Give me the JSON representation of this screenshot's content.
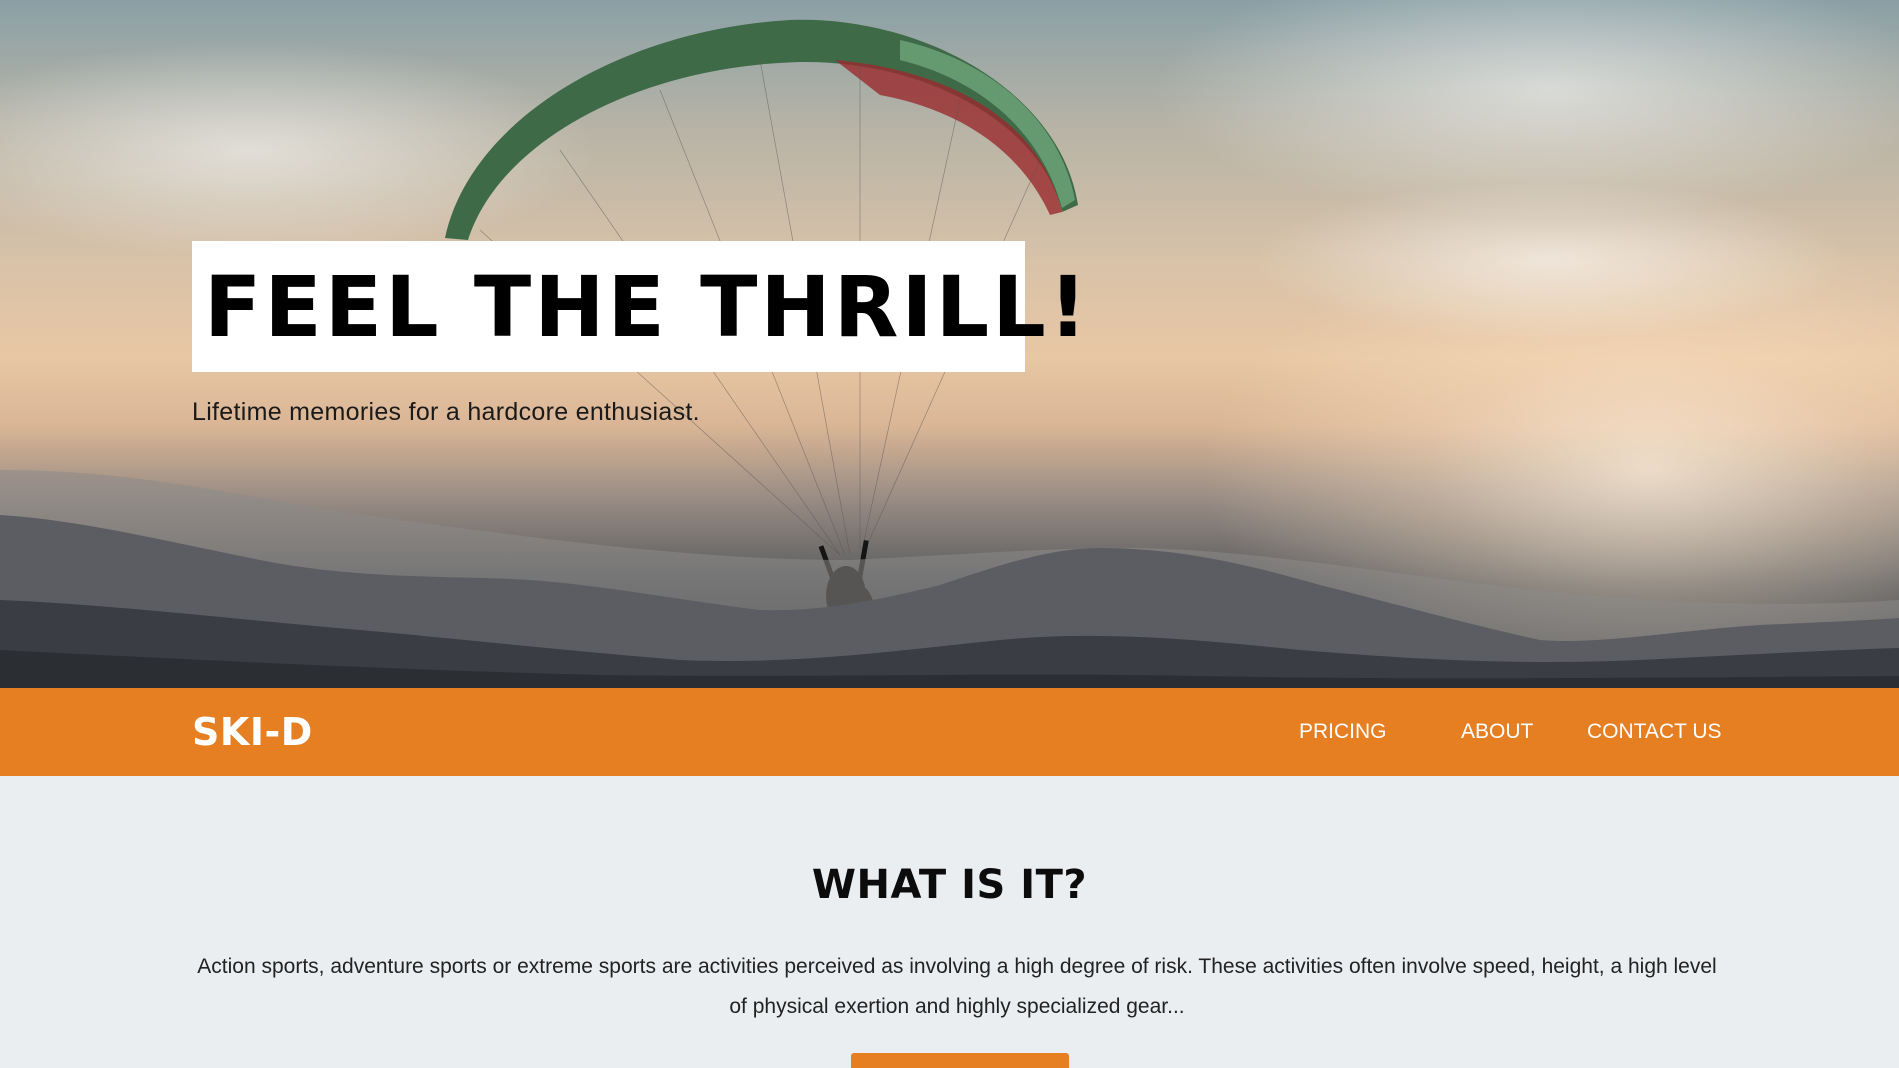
{
  "hero": {
    "title": "FEEL THE THRILL!",
    "subtitle": "Lifetime memories for a hardcore enthusiast."
  },
  "navbar": {
    "brand": "SKI-D",
    "links": [
      {
        "label": "PRICING"
      },
      {
        "label": "ABOUT"
      },
      {
        "label": "CONTACT US"
      }
    ],
    "background_color": "#e67e22"
  },
  "about": {
    "title": "WHAT IS IT?",
    "text": "Action sports, adventure sports or extreme sports are activities perceived as involving a high degree of risk. These activities often involve speed, height, a high level of physical exertion and highly specialized gear..."
  },
  "colors": {
    "accent": "#e67e22",
    "page_background": "#ebeef0"
  }
}
